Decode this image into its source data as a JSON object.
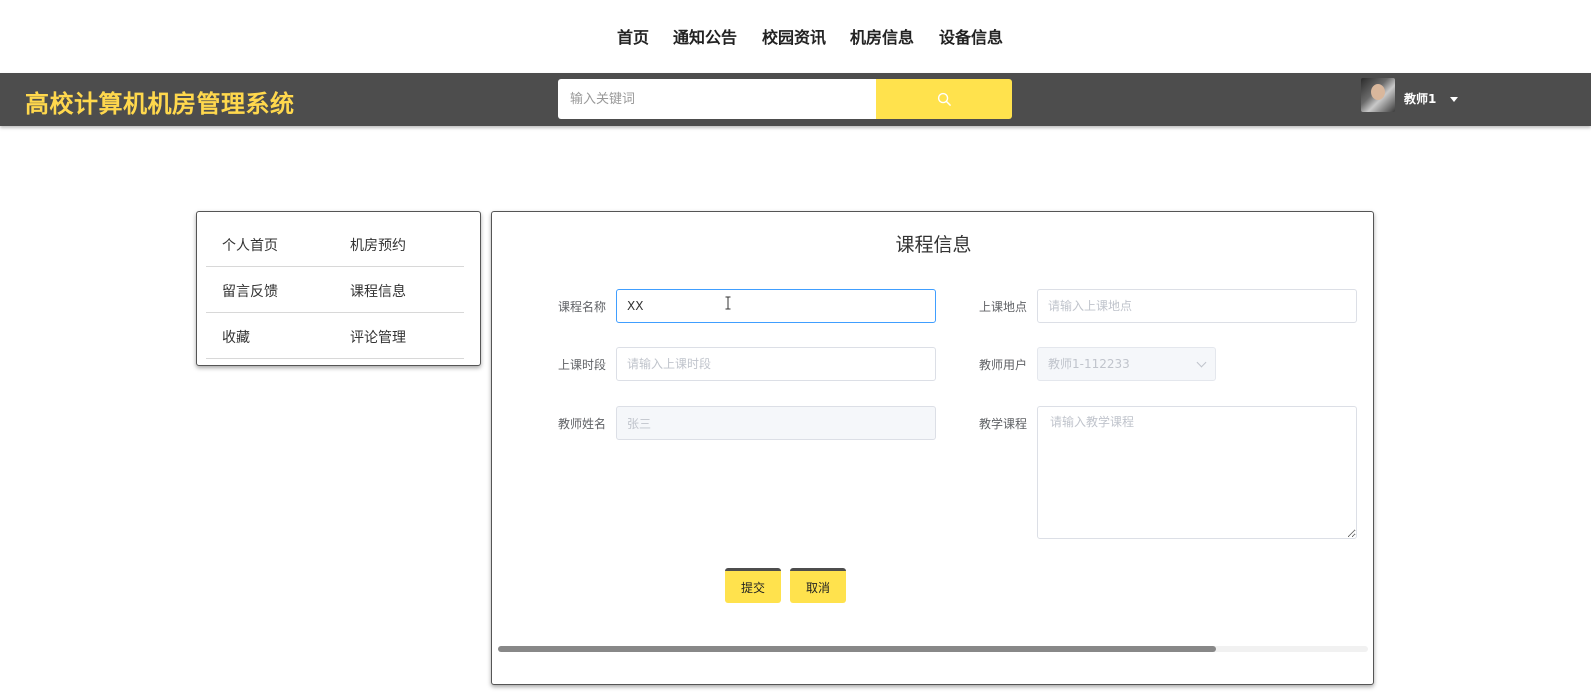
{
  "top_nav": {
    "items": [
      {
        "label": "首页"
      },
      {
        "label": "通知公告"
      },
      {
        "label": "校园资讯"
      },
      {
        "label": "机房信息"
      },
      {
        "label": "设备信息"
      }
    ]
  },
  "header": {
    "site_title": "高校计算机机房管理系统",
    "search": {
      "placeholder": "输入关键词",
      "icon": "search-icon"
    },
    "user": {
      "name": "教师1",
      "avatar_icon": "avatar",
      "menu_icon": "caret-down-icon"
    }
  },
  "side_menu": {
    "items": [
      {
        "label": "个人首页"
      },
      {
        "label": "机房预约"
      },
      {
        "label": "留言反馈"
      },
      {
        "label": "课程信息"
      },
      {
        "label": "收藏"
      },
      {
        "label": "评论管理"
      }
    ]
  },
  "course_form": {
    "title": "课程信息",
    "course_name": {
      "label": "课程名称",
      "value": "XX"
    },
    "location": {
      "label": "上课地点",
      "placeholder": "请输入上课地点"
    },
    "time_slot": {
      "label": "上课时段",
      "placeholder": "请输入上课时段"
    },
    "teacher_user": {
      "label": "教师用户",
      "value": "教师1-112233"
    },
    "teacher_name": {
      "label": "教师姓名",
      "value": "张三"
    },
    "teaching_course": {
      "label": "教学课程",
      "placeholder": "请输入教学课程"
    },
    "submit_label": "提交",
    "cancel_label": "取消"
  },
  "colors": {
    "accent": "#ffe24d",
    "title_yellow": "#ffd84d",
    "header_bg": "#4d4d4d",
    "focus_border": "#409eff"
  },
  "scrollbar": {
    "position_fraction": 0.0,
    "visible_fraction": 0.82
  }
}
